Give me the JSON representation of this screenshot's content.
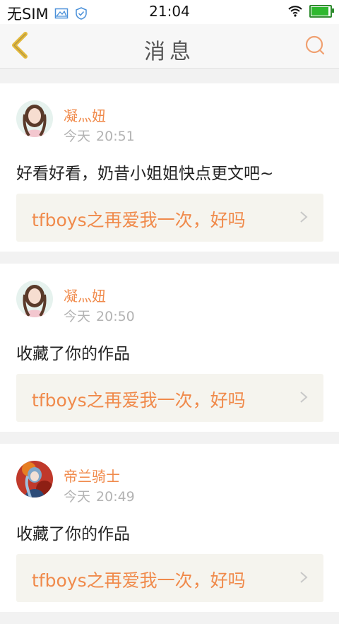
{
  "status_bar": {
    "carrier": "无SIM",
    "time": "21:04"
  },
  "header": {
    "title": "消息",
    "back_icon": "back-chevron-icon",
    "search_icon": "search-icon"
  },
  "colors": {
    "accent": "#f08a4b",
    "header_icon": "#e3b93b",
    "search_icon": "#f0a070",
    "card_box_bg": "#f5f4ee"
  },
  "messages": [
    {
      "username": "凝灬妞",
      "day": "今天",
      "time": "20:51",
      "text": "好看好看，奶昔小姐姐快点更文吧~",
      "work_title": "tfboys之再爱我一次，好吗"
    },
    {
      "username": "凝灬妞",
      "day": "今天",
      "time": "20:50",
      "text": "收藏了你的作品",
      "work_title": "tfboys之再爱我一次，好吗"
    },
    {
      "username": "帝兰骑士",
      "day": "今天",
      "time": "20:49",
      "text": "收藏了你的作品",
      "work_title": "tfboys之再爱我一次，好吗"
    }
  ]
}
